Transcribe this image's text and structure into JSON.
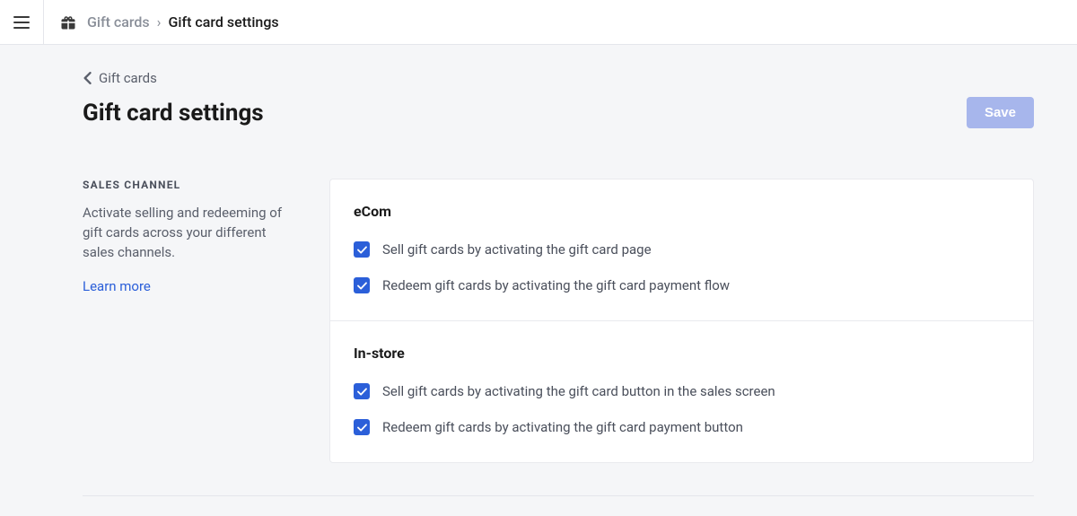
{
  "breadcrumb": {
    "parent": "Gift cards",
    "separator": "›",
    "current": "Gift card settings"
  },
  "back": {
    "label": "Gift cards"
  },
  "page": {
    "title": "Gift card settings",
    "save_label": "Save"
  },
  "sidebar": {
    "label": "SALES CHANNEL",
    "description": "Activate selling and redeeming of gift cards across your different sales channels.",
    "learn_more": "Learn more"
  },
  "channels": {
    "ecom": {
      "title": "eCom",
      "sell_label": "Sell gift cards by activating the gift card page",
      "redeem_label": "Redeem gift cards by activating the gift card payment flow"
    },
    "instore": {
      "title": "In-store",
      "sell_label": "Sell gift cards by activating the gift card button in the sales screen",
      "redeem_label": "Redeem gift cards by activating the gift card payment button"
    }
  }
}
